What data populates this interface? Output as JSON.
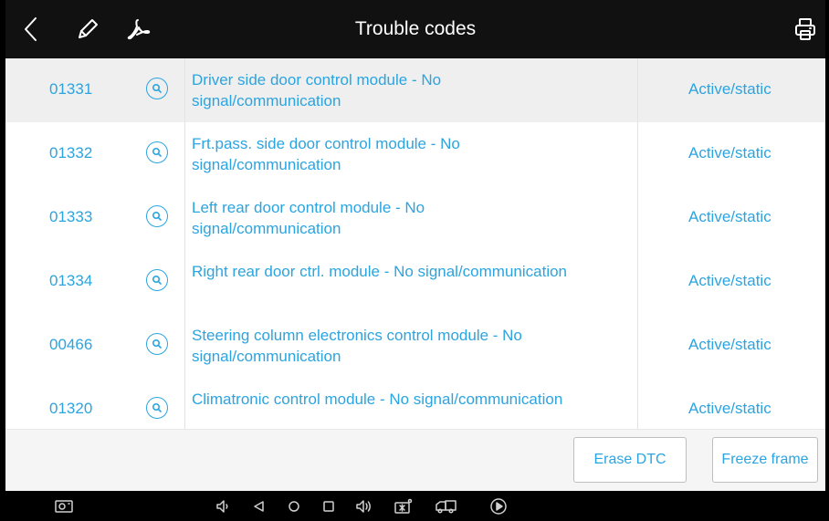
{
  "header": {
    "title": "Trouble codes",
    "icons": [
      "back-icon",
      "pencil-icon",
      "pdf-icon",
      "print-icon"
    ]
  },
  "dtc_list": [
    {
      "code": "01331",
      "description": "Driver side door control module - No signal/communication",
      "status": "Active/static",
      "selected": true
    },
    {
      "code": "01332",
      "description": "Frt.pass. side door control module - No signal/communication",
      "status": "Active/static"
    },
    {
      "code": "01333",
      "description": "Left rear door control module - No signal/communication",
      "status": "Active/static"
    },
    {
      "code": "01334",
      "description": "Right rear door ctrl. module - No signal/communication",
      "status": "Active/static"
    },
    {
      "code": "00466",
      "description": "Steering column electronics control module - No signal/communication",
      "status": "Active/static"
    },
    {
      "code": "01320",
      "description": "Climatronic control module - No signal/communication",
      "status": "Active/static"
    }
  ],
  "footer": {
    "erase_label": "Erase DTC",
    "freeze_label": "Freeze frame"
  },
  "colors": {
    "accent": "#2ba4e0",
    "header_bg": "#111111",
    "selected_row": "#efefef"
  },
  "nav_icons": [
    "screenshot-icon",
    "volume-down-icon",
    "back-nav-icon",
    "home-icon",
    "recents-icon",
    "volume-up-icon",
    "vci-icon",
    "truck-icon",
    "play-icon"
  ]
}
